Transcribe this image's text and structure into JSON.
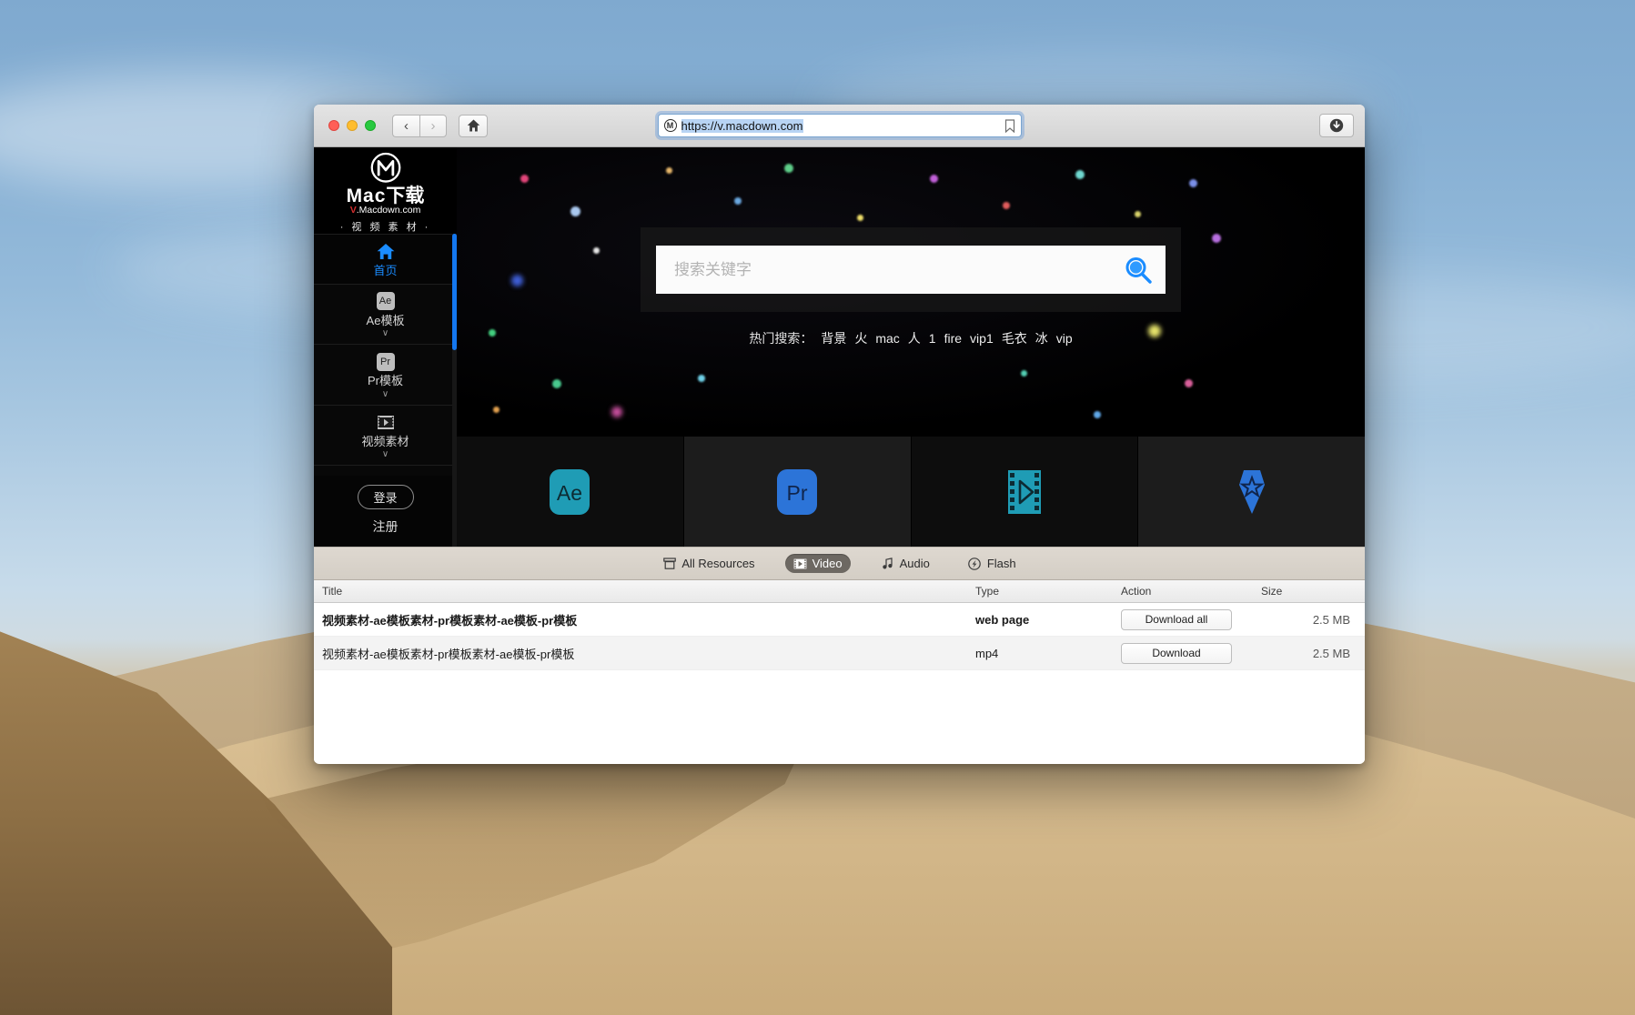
{
  "browser": {
    "url": "https://v.macdown.com",
    "site_icon": "macdown-circle-icon",
    "back_label": "‹",
    "forward_label": "›",
    "home_icon": "home-icon",
    "bookmark_icon": "bookmark-icon",
    "download_icon": "download-circle-icon",
    "traffic_lights": [
      "close",
      "minimize",
      "zoom"
    ]
  },
  "sidebar": {
    "brand": {
      "logo": "macdown-m-logo",
      "word_en": "Mac",
      "word_cn": "下载",
      "domain_prefix": "V",
      "domain_rest": ".Macdown.com",
      "subtitle": "· 视 频 素 材 ·"
    },
    "items": [
      {
        "label": "首页",
        "icon": "home-icon",
        "icon_text": "",
        "caret": "",
        "active": true
      },
      {
        "label": "Ae模板",
        "icon": "ae-badge-icon",
        "icon_text": "Ae",
        "caret": "∨",
        "active": false
      },
      {
        "label": "Pr模板",
        "icon": "pr-badge-icon",
        "icon_text": "Pr",
        "caret": "∨",
        "active": false
      },
      {
        "label": "视频素材",
        "icon": "film-strip-icon",
        "icon_text": "",
        "caret": "∨",
        "active": false
      },
      {
        "label": "",
        "icon": "audio-badge-icon",
        "icon_text": "",
        "caret": "",
        "active": false
      }
    ],
    "login_label": "登录",
    "register_label": "注册"
  },
  "hero": {
    "search_placeholder": "搜索关键字",
    "search_value": "",
    "search_icon": "search-magnifier-icon",
    "hot_label": "热门搜索：",
    "hot_tags": [
      "背景",
      "火",
      "mac",
      "人",
      "1",
      "fire",
      "vip1",
      "毛衣",
      "冰",
      "vip"
    ]
  },
  "tiles": [
    {
      "name": "ae-tile",
      "label": "Ae",
      "color": "#1f9cb5"
    },
    {
      "name": "pr-tile",
      "label": "Pr",
      "color": "#2c74d8"
    },
    {
      "name": "video-tile",
      "label": "",
      "color": "#1f9cb5"
    },
    {
      "name": "vip-tile",
      "label": "",
      "color": "#2c74d8"
    }
  ],
  "download_panel": {
    "tabs": [
      {
        "label": "All Resources",
        "icon": "archive-icon",
        "selected": false
      },
      {
        "label": "Video",
        "icon": "video-icon",
        "selected": true
      },
      {
        "label": "Audio",
        "icon": "music-note-icon",
        "selected": false
      },
      {
        "label": "Flash",
        "icon": "flash-icon",
        "selected": false
      }
    ],
    "columns": [
      "Title",
      "Type",
      "Action",
      "Size"
    ],
    "rows": [
      {
        "title": "视频素材-ae模板素材-pr模板素材-ae模板-pr模板",
        "type": "web page",
        "action": "Download all",
        "size": "2.5 MB",
        "bold": true
      },
      {
        "title": "视频素材-ae模板素材-pr模板素材-ae模板-pr模板",
        "type": "mp4",
        "action": "Download",
        "size": "2.5 MB",
        "bold": false
      }
    ]
  }
}
